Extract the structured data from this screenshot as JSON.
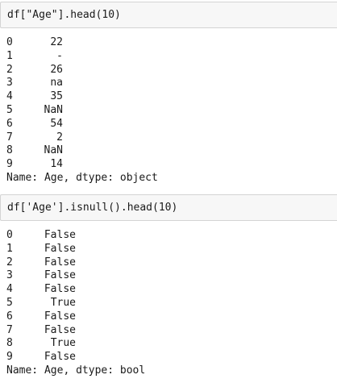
{
  "cells": [
    {
      "code": "df[\"Age\"].head(10)",
      "rows": [
        {
          "index": "0",
          "value": "22"
        },
        {
          "index": "1",
          "value": "-"
        },
        {
          "index": "2",
          "value": "26"
        },
        {
          "index": "3",
          "value": "na"
        },
        {
          "index": "4",
          "value": "35"
        },
        {
          "index": "5",
          "value": "NaN"
        },
        {
          "index": "6",
          "value": "54"
        },
        {
          "index": "7",
          "value": "2"
        },
        {
          "index": "8",
          "value": "NaN"
        },
        {
          "index": "9",
          "value": "14"
        }
      ],
      "footer": "Name: Age, dtype: object"
    },
    {
      "code": "df['Age'].isnull().head(10)",
      "rows": [
        {
          "index": "0",
          "value": "False"
        },
        {
          "index": "1",
          "value": "False"
        },
        {
          "index": "2",
          "value": "False"
        },
        {
          "index": "3",
          "value": "False"
        },
        {
          "index": "4",
          "value": "False"
        },
        {
          "index": "5",
          "value": "True"
        },
        {
          "index": "6",
          "value": "False"
        },
        {
          "index": "7",
          "value": "False"
        },
        {
          "index": "8",
          "value": "True"
        },
        {
          "index": "9",
          "value": "False"
        }
      ],
      "footer": "Name: Age, dtype: bool"
    }
  ]
}
